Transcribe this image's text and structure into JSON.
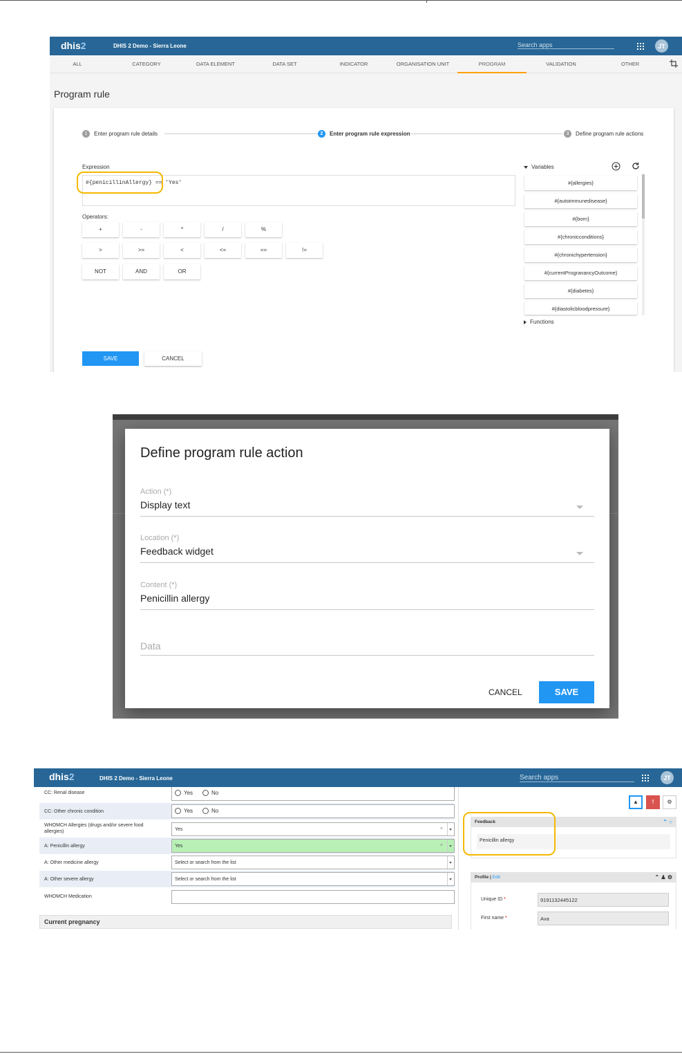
{
  "screen1": {
    "header": {
      "logo_main": "dhis",
      "logo_num": "2",
      "instance": "DHIS 2 Demo - Sierra Leone",
      "search_placeholder": "Search apps",
      "avatar": "JT"
    },
    "tabs": [
      "ALL",
      "CATEGORY",
      "DATA ELEMENT",
      "DATA SET",
      "INDICATOR",
      "ORGANISATION UNIT",
      "PROGRAM",
      "VALIDATION",
      "OTHER"
    ],
    "active_tab": "PROGRAM",
    "page_title": "Program rule",
    "steps": [
      {
        "num": "1",
        "label": "Enter program rule details"
      },
      {
        "num": "2",
        "label": "Enter program rule expression"
      },
      {
        "num": "3",
        "label": "Define program rule actions"
      }
    ],
    "expression_label": "Expression",
    "expression_value": "#{penicillinAllergy} == 'Yes'",
    "operators_label": "Operators:",
    "operators_row1": [
      "+",
      "-",
      "*",
      "/",
      "%"
    ],
    "operators_row2": [
      ">",
      ">=",
      "<",
      "<=",
      "==",
      "!="
    ],
    "operators_row3": [
      "NOT",
      "AND",
      "OR"
    ],
    "variables_label": "Variables",
    "variables": [
      "#{allergies}",
      "#{autoimmunedisease}",
      "#{born}",
      "#{chronicconditions}",
      "#{chronichypertension}",
      "#{currentProgranancyOutcome}",
      "#{diabetes}",
      "#{diastolicbloodpressure}"
    ],
    "functions_label": "Functions",
    "save_label": "SAVE",
    "cancel_label": "CANCEL",
    "accent_color": "#2196f3",
    "highlight_color": "#f5b800"
  },
  "screen2": {
    "title": "Define program rule action",
    "fields": [
      {
        "label": "Action (*)",
        "value": "Display text",
        "dropdown": true
      },
      {
        "label": "Location (*)",
        "value": "Feedback widget",
        "dropdown": true
      },
      {
        "label": "Content (*)",
        "value": "Penicillin allergy",
        "dropdown": false
      },
      {
        "label": "Data",
        "value": "",
        "dropdown": false
      }
    ],
    "cancel_label": "CANCEL",
    "save_label": "SAVE"
  },
  "screen3": {
    "header": {
      "logo_main": "dhis",
      "logo_num": "2",
      "instance": "DHIS 2 Demo - Sierra Leone",
      "search_placeholder": "Search apps",
      "avatar": "JT"
    },
    "rows": [
      {
        "label": "CC: Renal disease",
        "type": "radio",
        "opt1": "Yes",
        "opt2": "No"
      },
      {
        "label": "CC: Other chronic condition",
        "type": "radio",
        "opt1": "Yes",
        "opt2": "No"
      },
      {
        "label": "WHOMCH Allergies (drugs and/or severe food allergies)",
        "type": "select",
        "value": "Yes"
      },
      {
        "label": "A: Penicillin allergy",
        "type": "select",
        "value": "Yes"
      },
      {
        "label": "A: Other medicine allergy",
        "type": "select",
        "value": "Select or search from the list"
      },
      {
        "label": "A: Other severe allergy",
        "type": "select",
        "value": "Select or search from the list"
      },
      {
        "label": "WHOMCH Medication",
        "type": "text",
        "value": ""
      }
    ],
    "section_title": "Current pregnancy",
    "feedback_title": "Feedback",
    "feedback_text": "Penicillin allergy",
    "profile_title": "Profile | ",
    "profile_edit": "Edit",
    "profile_fields": [
      {
        "label": "Unique ID",
        "value": "9191132445122"
      },
      {
        "label": "First name",
        "value": "Ava"
      }
    ],
    "required_mark": "*"
  }
}
